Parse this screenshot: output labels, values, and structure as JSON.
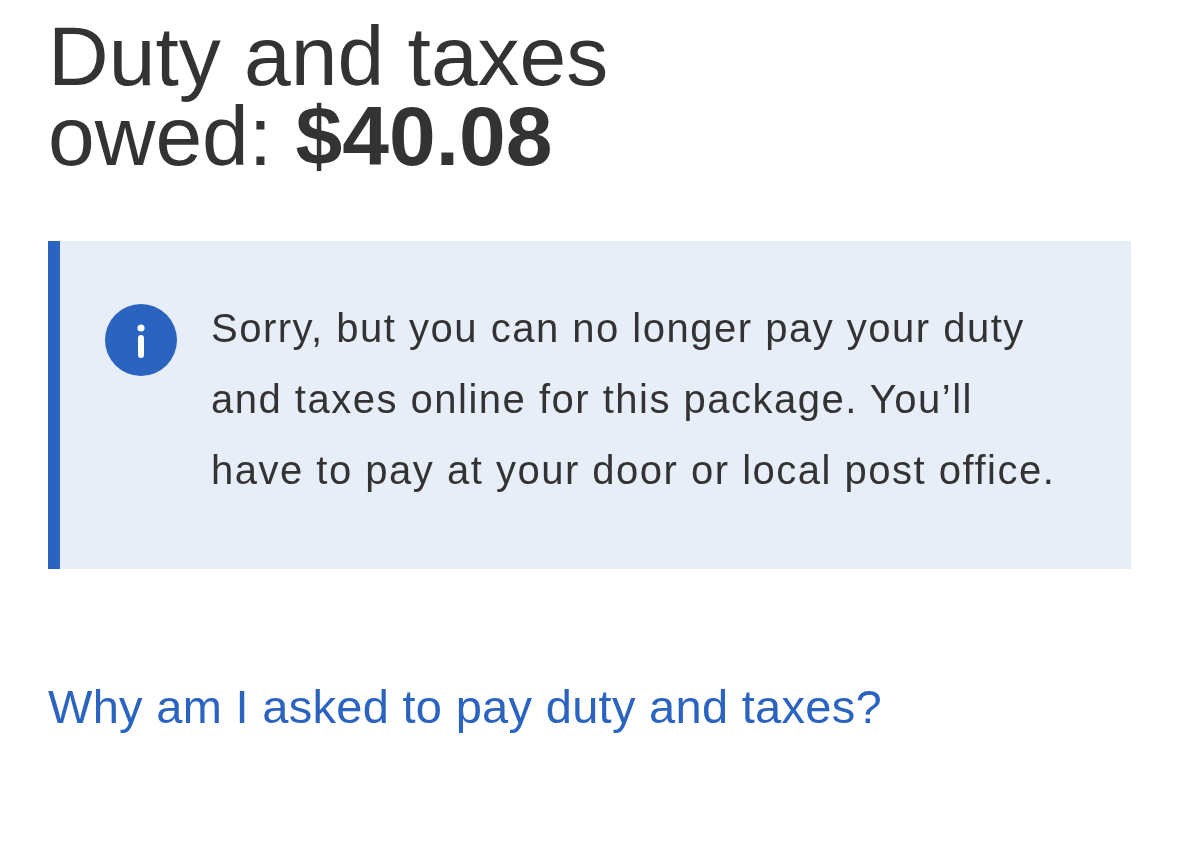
{
  "title": "Duty and taxes owed: **$40.08**",
  "notice": {
    "kind": "info",
    "message": "Sorry, but you can no longer pay your duty and taxes online for this package. You’ll have to pay at your door or local post office."
  },
  "help_link": {
    "text": "Why am I asked to pay duty and taxes?"
  }
}
